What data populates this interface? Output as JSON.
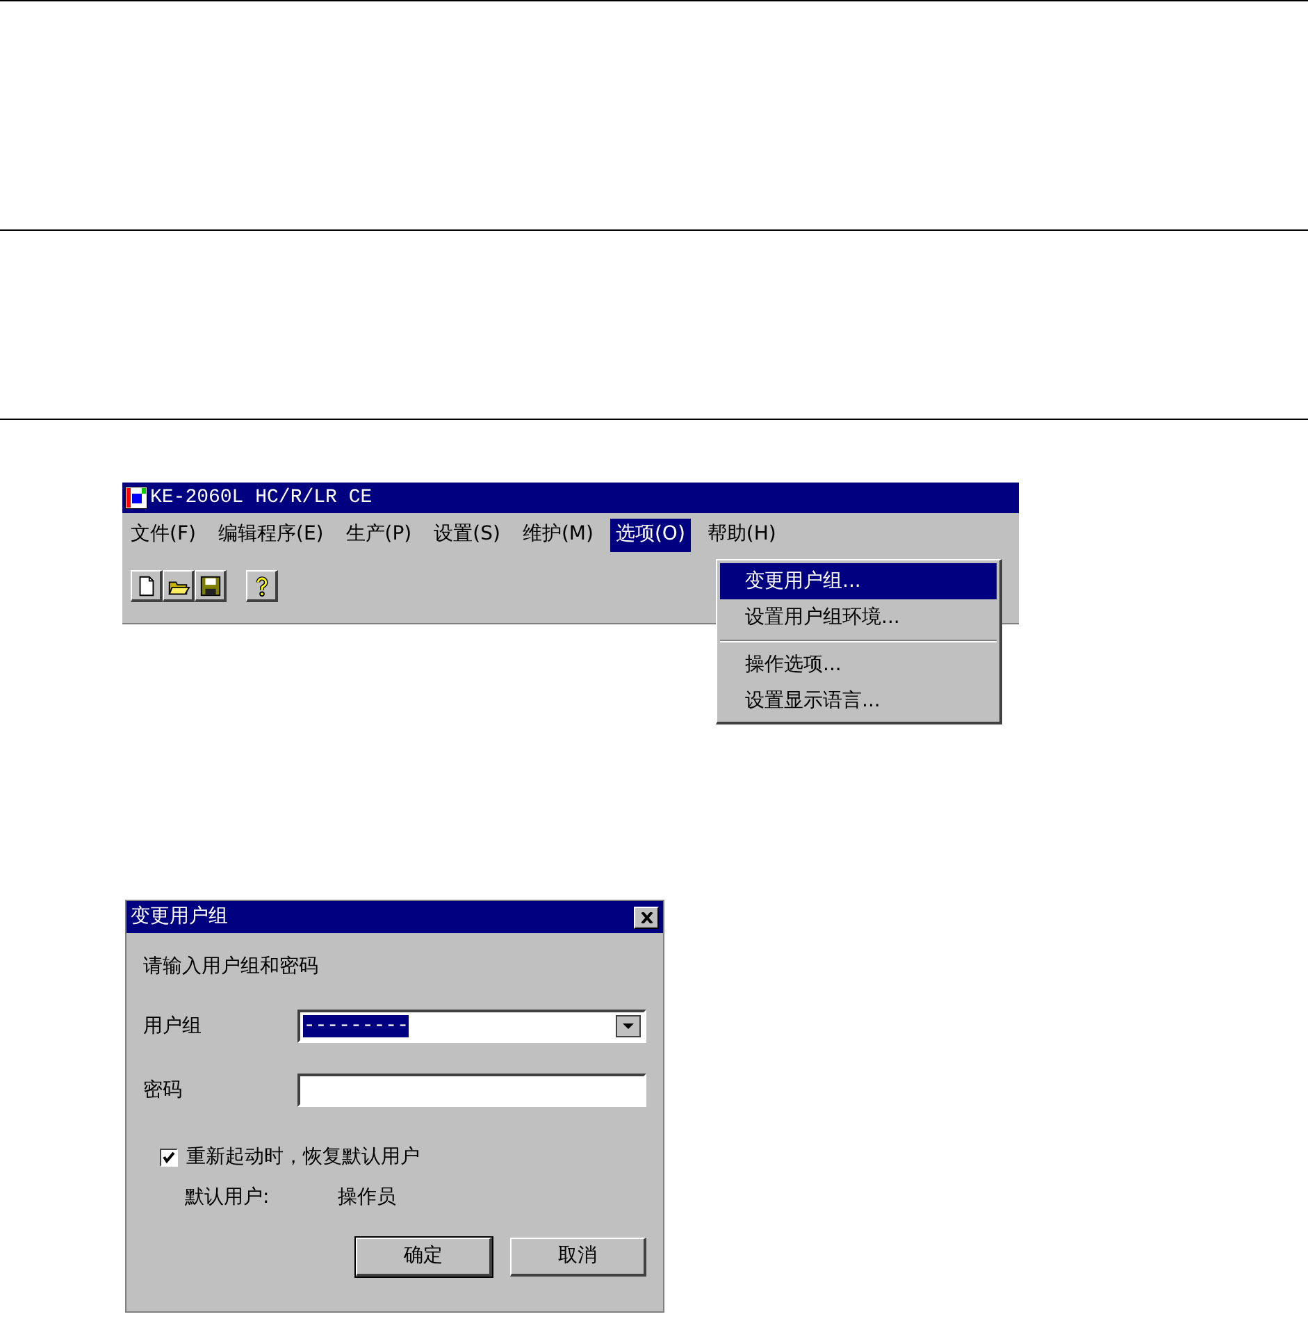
{
  "app_window": {
    "title": "KE-2060L HC/R/LR CE",
    "menus": [
      {
        "label": "文件(F)",
        "selected": false
      },
      {
        "label": "编辑程序(E)",
        "selected": false
      },
      {
        "label": "生产(P)",
        "selected": false
      },
      {
        "label": "设置(S)",
        "selected": false
      },
      {
        "label": "维护(M)",
        "selected": false
      },
      {
        "label": "选项(O)",
        "selected": true
      },
      {
        "label": "帮助(H)",
        "selected": false
      }
    ],
    "dropdown": {
      "items": [
        {
          "kind": "item",
          "label": "变更用户组...",
          "selected": true
        },
        {
          "kind": "item",
          "label": "设置用户组环境...",
          "selected": false
        },
        {
          "kind": "separator"
        },
        {
          "kind": "item",
          "label": "操作选项...",
          "selected": false
        },
        {
          "kind": "item",
          "label": "设置显示语言...",
          "selected": false
        }
      ]
    }
  },
  "dialog": {
    "title": "变更用户组",
    "prompt": "请输入用户组和密码",
    "fields": [
      {
        "kind": "dropdown",
        "label": "用户组",
        "value": "---------"
      },
      {
        "kind": "text",
        "label": "密码"
      }
    ],
    "checkbox": {
      "label": "重新起动时，恢复默认用户",
      "checked": true
    },
    "default_user": {
      "label": "默认用户:",
      "value": "操作员"
    },
    "buttons": [
      "确定",
      "取消"
    ]
  }
}
